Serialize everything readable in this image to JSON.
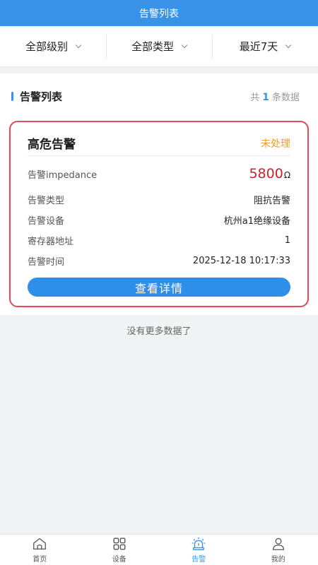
{
  "nav": {
    "title": "告警列表"
  },
  "filters": [
    {
      "label": "全部级别"
    },
    {
      "label": "全部类型"
    },
    {
      "label": "最近7天"
    }
  ],
  "list": {
    "title": "告警列表",
    "count_prefix": "共",
    "count": "1",
    "count_suffix": "条数据"
  },
  "alarm": {
    "level": "高危告警",
    "status": "未处理",
    "status_color": "#f0a020",
    "border_color": "#e04a5a",
    "rows": [
      {
        "key": "告警impedance",
        "value": "5800",
        "unit": "Ω"
      },
      {
        "key": "告警类型",
        "value": "阻抗告警"
      },
      {
        "key": "告警设备",
        "value": "杭州a1绝缘设备"
      },
      {
        "key": "寄存器地址",
        "value": "1"
      },
      {
        "key": "告警时间",
        "value": "2025-12-18 10:17:33"
      }
    ],
    "detail_button": "查看详情"
  },
  "footer": {
    "no_more": "没有更多数据了"
  },
  "tabs": [
    {
      "label": "首页",
      "icon": "home-icon",
      "active": false
    },
    {
      "label": "设备",
      "icon": "grid-icon",
      "active": false
    },
    {
      "label": "告警",
      "icon": "alarm-icon",
      "active": true
    },
    {
      "label": "我的",
      "icon": "user-icon",
      "active": false
    }
  ],
  "colors": {
    "accent": "#3a92e8",
    "danger": "#d0202a"
  }
}
